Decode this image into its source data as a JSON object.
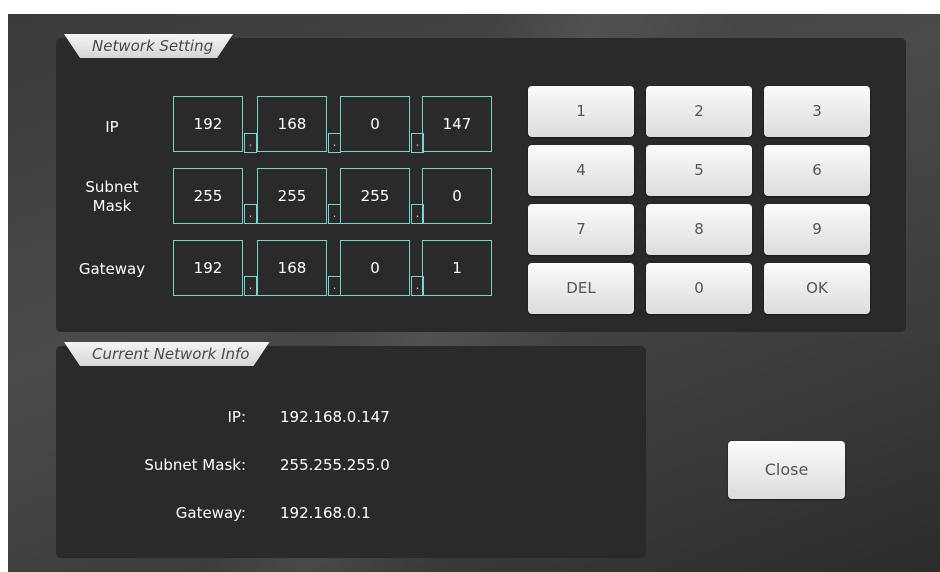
{
  "network_setting": {
    "title": "Network Setting",
    "rows": [
      {
        "label": "IP",
        "octets": [
          "192",
          "168",
          "0",
          "147"
        ]
      },
      {
        "label": "Subnet\nMask",
        "octets": [
          "255",
          "255",
          "255",
          "0"
        ]
      },
      {
        "label": "Gateway",
        "octets": [
          "192",
          "168",
          "0",
          "1"
        ]
      }
    ],
    "separator": "."
  },
  "keypad": {
    "keys": [
      "1",
      "2",
      "3",
      "4",
      "5",
      "6",
      "7",
      "8",
      "9",
      "DEL",
      "0",
      "OK"
    ]
  },
  "current_info": {
    "title": "Current Network Info",
    "ip_label": "IP:",
    "ip_value": "192.168.0.147",
    "subnet_label": "Subnet Mask:",
    "subnet_value": "255.255.255.0",
    "gateway_label": "Gateway:",
    "gateway_value": "192.168.0.1"
  },
  "close_label": "Close",
  "colors": {
    "field_border": "#7fd1cd",
    "panel_bg": "#2a2a2a",
    "key_bg": "#f0f0f0"
  }
}
